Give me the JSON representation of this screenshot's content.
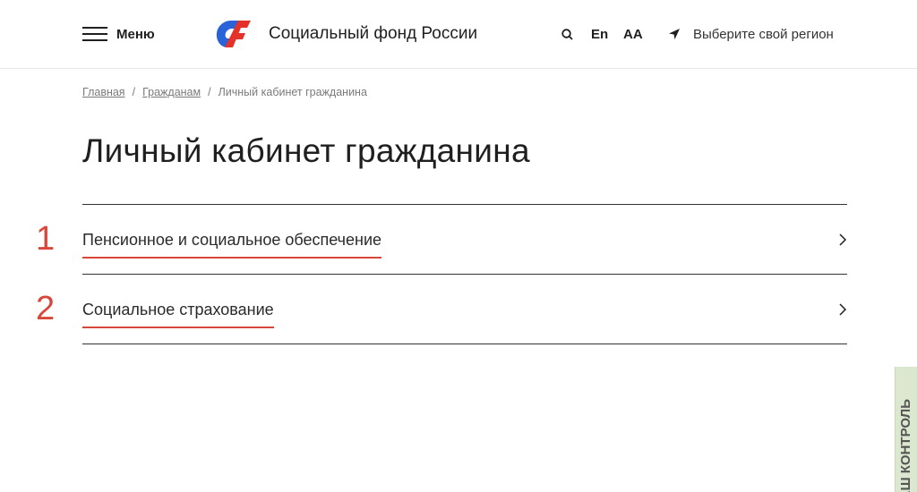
{
  "header": {
    "menu_label": "Меню",
    "brand_name": "Социальный фонд России",
    "lang_label": "En",
    "font_size_label": "АА",
    "region_label": "Выберите свой регион",
    "icons": [
      "menu-icon",
      "sfr-logo",
      "search-icon",
      "location-arrow-icon"
    ],
    "logo_colors": {
      "blue": "#2a63d8",
      "red": "#e5312a"
    }
  },
  "breadcrumb": {
    "items": [
      "Главная",
      "Гражданам",
      "Личный кабинет гражданина"
    ],
    "separator": "/"
  },
  "page_title": "Личный кабинет гражданина",
  "sections": [
    {
      "number": "1",
      "label": "Пенсионное и социальное обеспечение"
    },
    {
      "number": "2",
      "label": "Социальное страхование"
    }
  ],
  "side_tab": {
    "label": "АШ КОНТРОЛЬ"
  },
  "colors": {
    "accent": "#d9473a",
    "side_tab_bg": "#dbe8cf"
  }
}
